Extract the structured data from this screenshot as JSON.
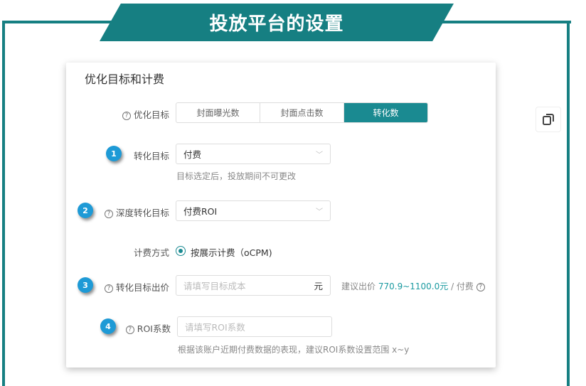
{
  "banner": {
    "title": "投放平台的设置"
  },
  "card": {
    "title": "优化目标和计费",
    "optimize": {
      "label": "优化目标",
      "options": [
        "封面曝光数",
        "封面点击数",
        "转化数"
      ],
      "selected": "转化数"
    },
    "conversion": {
      "badge": "1",
      "label": "转化目标",
      "value": "付费",
      "hint": "目标选定后，投放期间不可更改"
    },
    "deep": {
      "badge": "2",
      "label": "深度转化目标",
      "value": "付费ROI"
    },
    "billing": {
      "label": "计费方式",
      "option": "按展示计费（oCPM)"
    },
    "bid": {
      "badge": "3",
      "label": "转化目标出价",
      "placeholder": "请填写目标成本",
      "unit": "元",
      "suggest_prefix": "建议出价",
      "suggest_range": "770.9~1100.0元",
      "suggest_suffix": "/ 付费"
    },
    "roi": {
      "badge": "4",
      "label": "ROI系数",
      "placeholder": "请填写ROI系数",
      "hint": "根据该账户近期付费数据的表现，建议ROI系数设置范围 x~y"
    }
  },
  "colors": {
    "teal": "#167f82",
    "accent": "#1a8a91",
    "badge": "#1e9ad6"
  }
}
